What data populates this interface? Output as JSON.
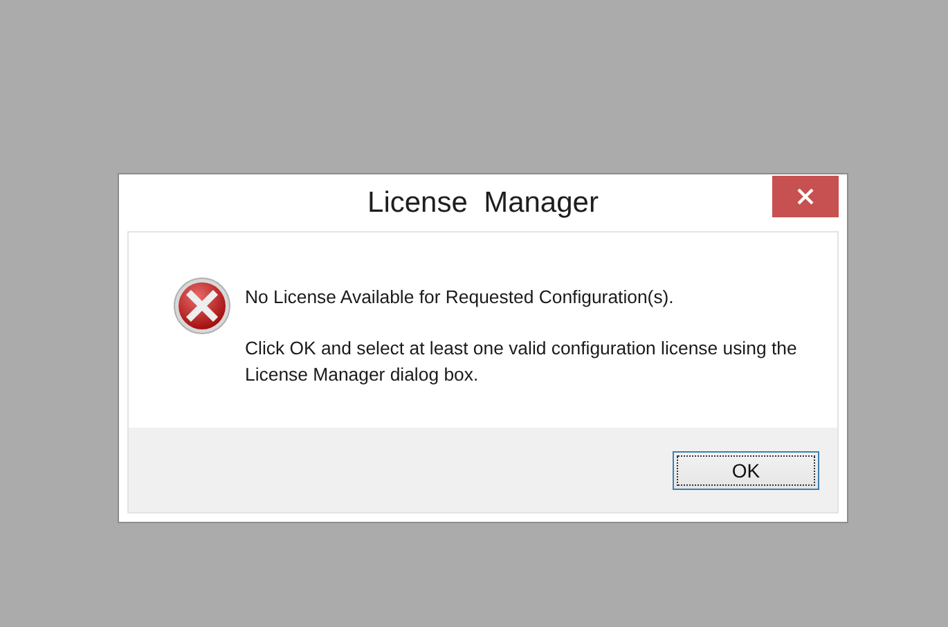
{
  "window": {
    "title": "License  Manager"
  },
  "message": {
    "heading": "No License Available for Requested Configuration(s).",
    "body": "Click OK and select at least one valid configuration license using the License Manager dialog box."
  },
  "buttons": [
    {
      "label": "OK",
      "focused": true
    }
  ]
}
